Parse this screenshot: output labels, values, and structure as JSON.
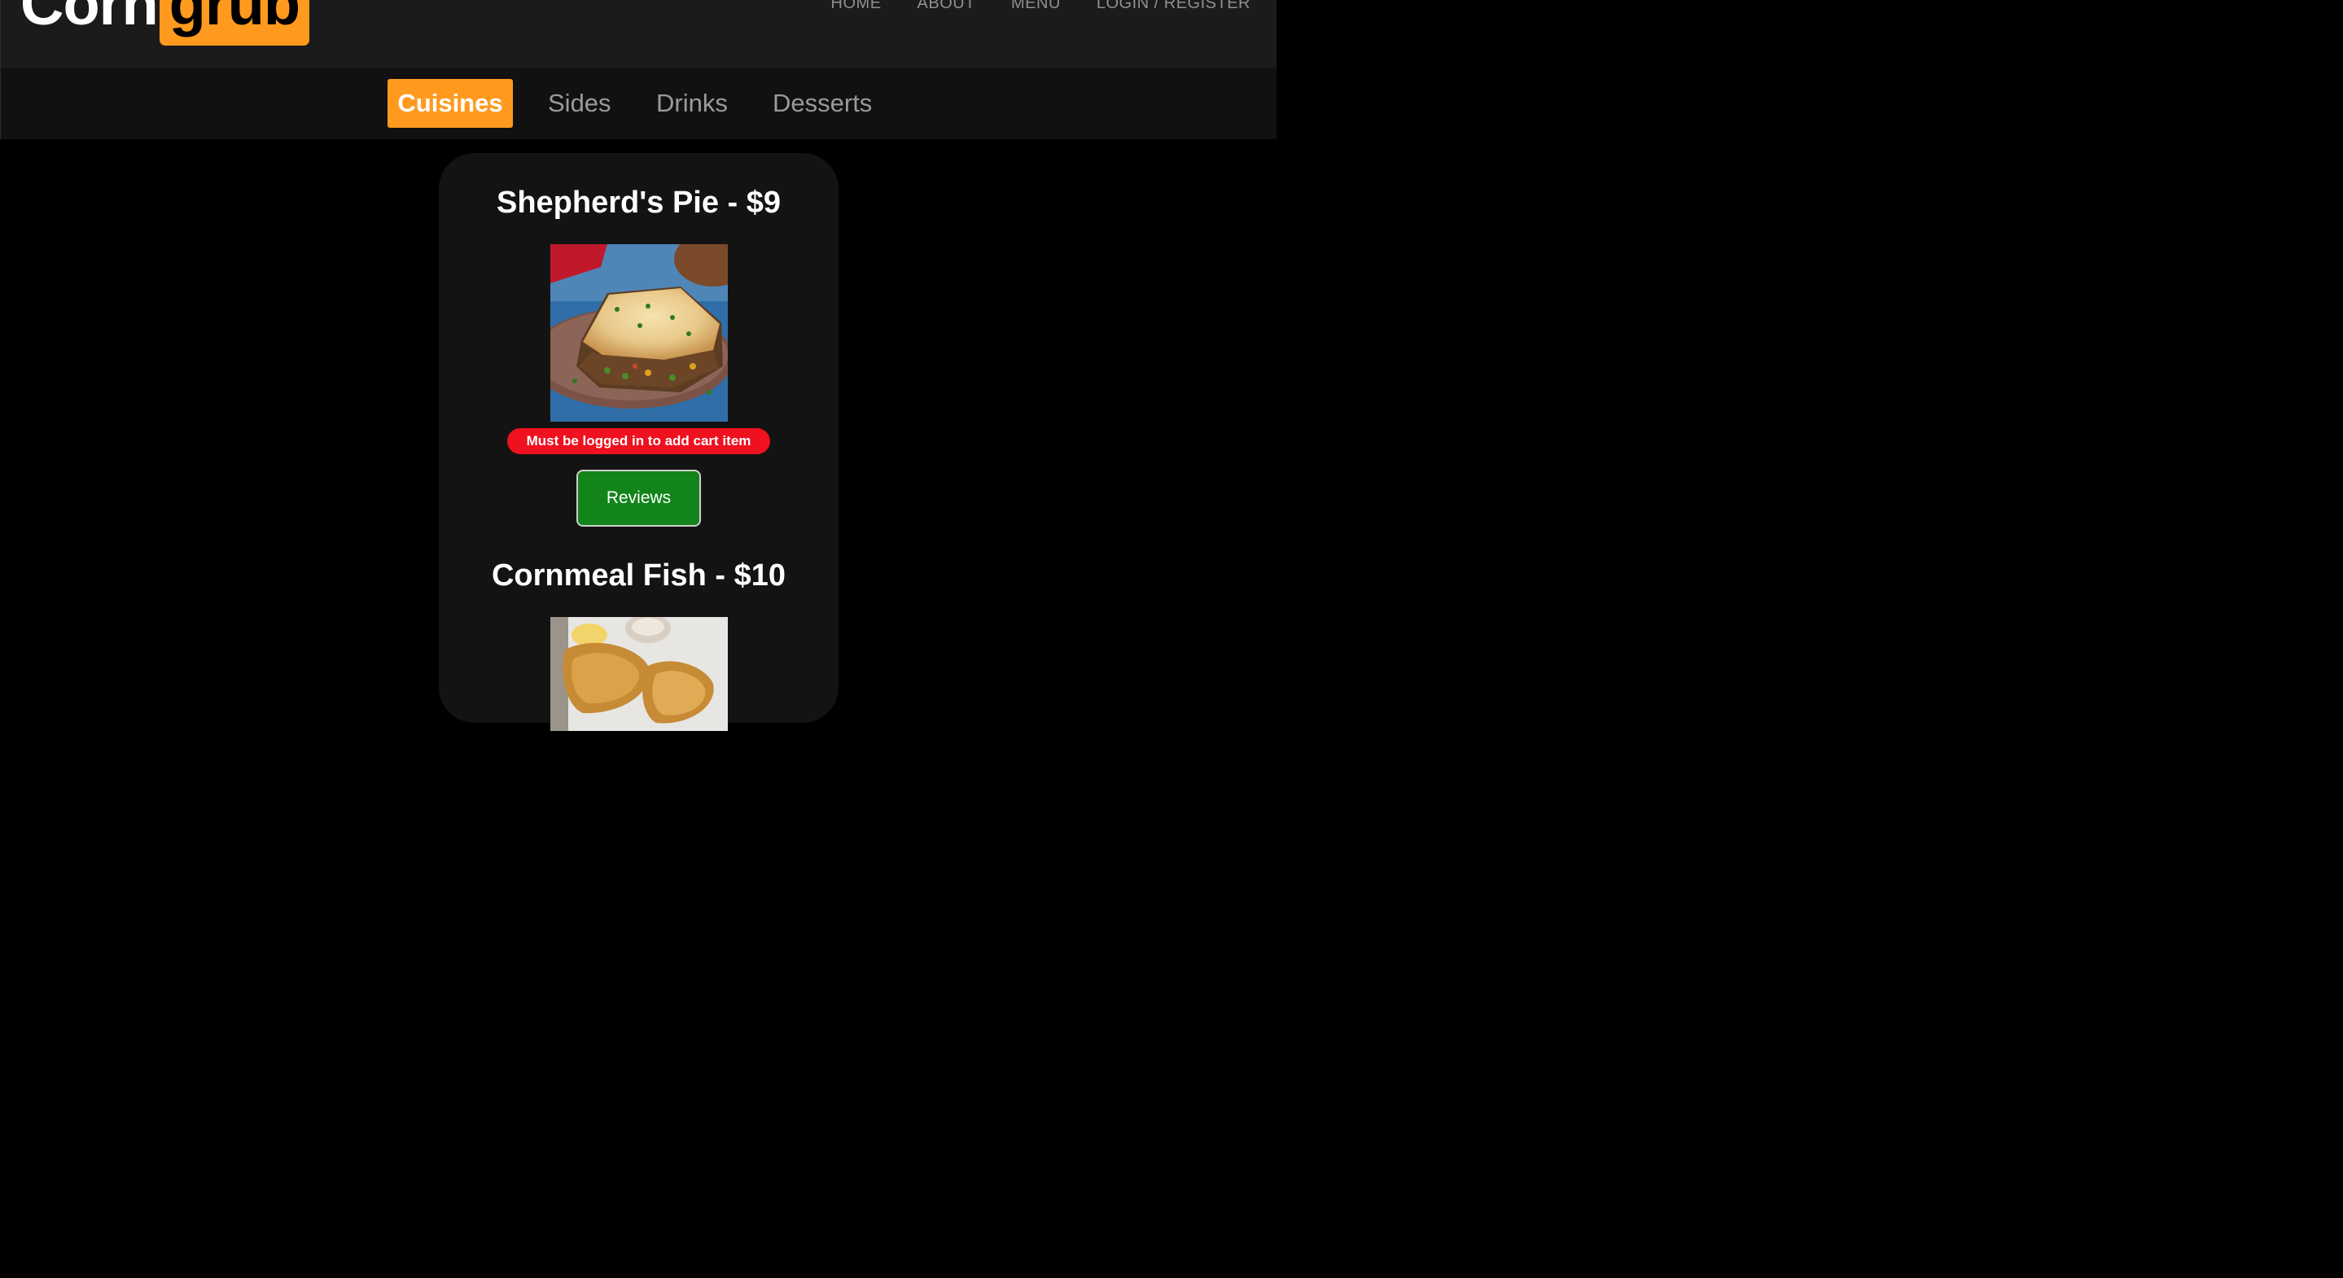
{
  "brand": {
    "part1": "Corn",
    "part2": "grub"
  },
  "topnav": [
    {
      "label": "HOME"
    },
    {
      "label": "ABOUT"
    },
    {
      "label": "MENU"
    },
    {
      "label": "LOGIN / REGISTER"
    }
  ],
  "categories": [
    {
      "label": "Cuisines",
      "active": true
    },
    {
      "label": "Sides"
    },
    {
      "label": "Drinks"
    },
    {
      "label": "Desserts"
    }
  ],
  "items": [
    {
      "title": "Shepherd's Pie - $9",
      "warning": "Must be logged in to add cart item",
      "reviews_label": "Reviews"
    },
    {
      "title": "Cornmeal Fish - $10"
    }
  ],
  "colors": {
    "accent": "#ff9a1f",
    "warning": "#ef1020",
    "reviews_button": "#13841a"
  }
}
